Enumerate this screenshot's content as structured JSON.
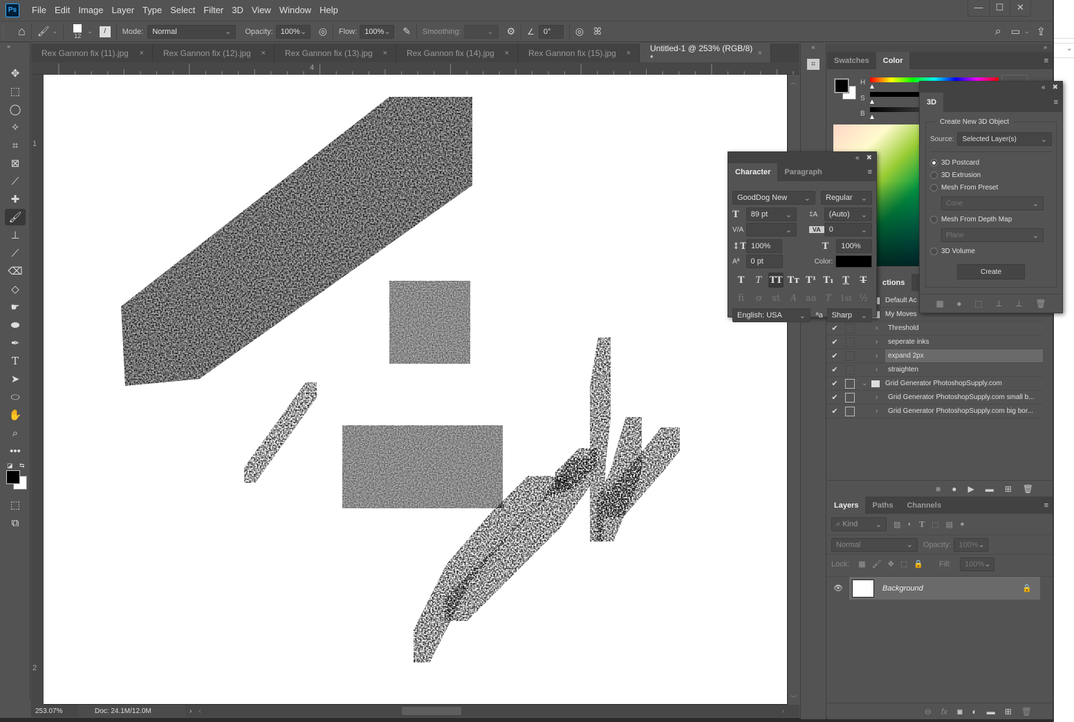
{
  "app": {
    "logo": "Ps"
  },
  "menu": [
    "File",
    "Edit",
    "Image",
    "Layer",
    "Type",
    "Select",
    "Filter",
    "3D",
    "View",
    "Window",
    "Help"
  ],
  "window_controls": {
    "minimize": "—",
    "maximize": "☐",
    "close": "✕"
  },
  "options": {
    "brush_size": "12",
    "mode_label": "Mode:",
    "mode_value": "Normal",
    "opacity_label": "Opacity:",
    "opacity_value": "100%",
    "flow_label": "Flow:",
    "flow_value": "100%",
    "smoothing_label": "Smoothing:",
    "smoothing_value": "",
    "angle_value": "0°"
  },
  "tabs": [
    {
      "label": "Rex Gannon fix (11).jpg",
      "active": false
    },
    {
      "label": "Rex Gannon fix (12).jpg",
      "active": false
    },
    {
      "label": "Rex Gannon fix (13).jpg",
      "active": false
    },
    {
      "label": "Rex Gannon fix (14).jpg",
      "active": false
    },
    {
      "label": "Rex Gannon fix (15).jpg",
      "active": false
    },
    {
      "label": "Untitled-1 @ 253% (RGB/8) *",
      "active": true
    }
  ],
  "tab_close": "×",
  "rulers": {
    "top_labels": [
      "4"
    ],
    "left_labels": [
      "1",
      "2"
    ]
  },
  "status": {
    "zoom": "253.07%",
    "doc": "Doc: 24.1M/12.0M"
  },
  "color_panel": {
    "tabs": [
      "Swatches",
      "Color"
    ],
    "active_tab": "Color",
    "sliders": [
      "H",
      "S",
      "B"
    ],
    "foreground": "#000000",
    "background": "#ffffff"
  },
  "panel_3d": {
    "tab": "3D",
    "group_title": "Create New 3D Object",
    "source_label": "Source:",
    "source_value": "Selected Layer(s)",
    "options": [
      {
        "label": "3D Postcard",
        "selected": true
      },
      {
        "label": "3D Extrusion",
        "selected": false
      },
      {
        "label": "Mesh From Preset",
        "selected": false
      },
      {
        "label": "Mesh From Depth Map",
        "selected": false
      },
      {
        "label": "3D Volume",
        "selected": false
      }
    ],
    "preset_value": "Cone",
    "depthmap_value": "Plane",
    "create_label": "Create"
  },
  "character": {
    "tabs": [
      "Character",
      "Paragraph"
    ],
    "font_family": "GoodDog New",
    "font_style": "Regular",
    "font_size": "89 pt",
    "leading": "(Auto)",
    "kerning": "",
    "tracking": "0",
    "vscale": "100%",
    "hscale": "100%",
    "baseline": "0 pt",
    "color_label": "Color:",
    "color": "#000000",
    "format_buttons": [
      "T",
      "T",
      "TT",
      "Tт",
      "T¹",
      "T₁",
      "T",
      "T"
    ],
    "opentype_buttons": [
      "fi",
      "ơ",
      "st",
      "A",
      "aa",
      "T",
      "1st",
      "½"
    ],
    "language": "English: USA",
    "aa_icon": "ªa",
    "antialias": "Sharp"
  },
  "actions": {
    "tab_partial": "ctions",
    "items": [
      {
        "check": "",
        "name": "Default Ac",
        "type": "set",
        "expanded": false,
        "selected": false
      },
      {
        "check": "",
        "name": "My Moves",
        "type": "set",
        "expanded": true,
        "selected": false
      },
      {
        "check": "✔",
        "name": "Threshold",
        "type": "action",
        "selected": false
      },
      {
        "check": "✔",
        "name": "seperate inks",
        "type": "action",
        "selected": false
      },
      {
        "check": "✔",
        "name": "expand 2px",
        "type": "action",
        "selected": true
      },
      {
        "check": "✔",
        "name": "straighten",
        "type": "action",
        "selected": false
      },
      {
        "check": "✔",
        "name": "Grid Generator PhotoshopSupply.com",
        "type": "set",
        "expanded": true,
        "selected": false
      },
      {
        "check": "✔",
        "name": "Grid Generator PhotoshopSupply.com small b...",
        "type": "action",
        "selected": false
      },
      {
        "check": "✔",
        "name": "Grid Generator PhotoshopSupply.com big bor...",
        "type": "action",
        "selected": false
      }
    ]
  },
  "layers": {
    "tabs": [
      "Layers",
      "Paths",
      "Channels"
    ],
    "filter_value": "Kind",
    "blend_mode": "Normal",
    "opacity_label": "Opacity:",
    "opacity_value": "100%",
    "lock_label": "Lock:",
    "fill_label": "Fill:",
    "fill_value": "100%",
    "items": [
      {
        "name": "Background",
        "visible": true,
        "locked": true
      }
    ]
  }
}
